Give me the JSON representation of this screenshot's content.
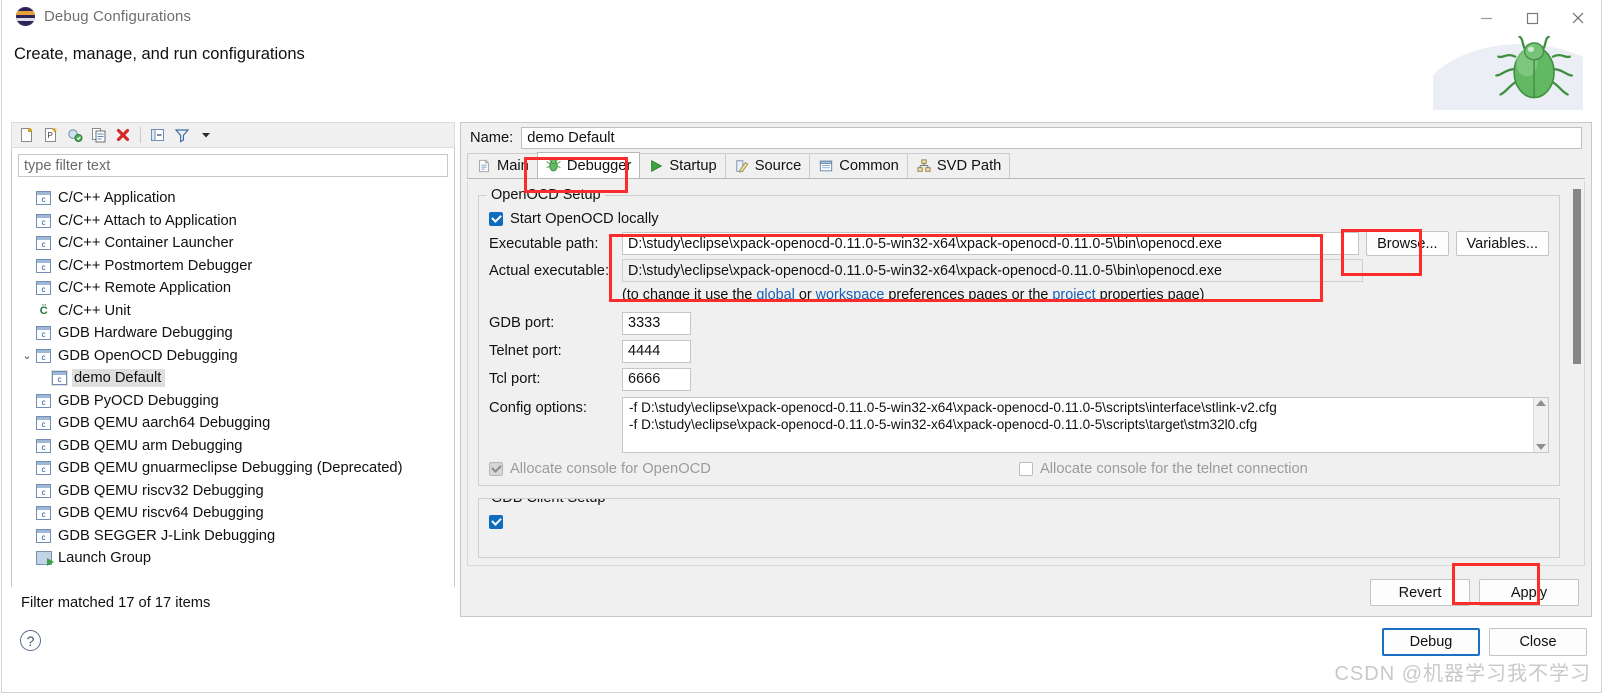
{
  "window": {
    "title": "Debug Configurations",
    "subtitle": "Create, manage, and run configurations",
    "logo_icon": "eclipse-logo",
    "bug_icon": "bug-icon",
    "minimize_label": "—",
    "maximize_label": "□",
    "close_label": "✕"
  },
  "tree_toolbar": {
    "icons": [
      "new-configuration-icon",
      "new-prototype-icon",
      "export-icon",
      "duplicate-icon",
      "delete-icon",
      "collapse-all-icon",
      "filter-icon",
      "view-menu-icon"
    ]
  },
  "filter": {
    "placeholder": "type filter text",
    "value": "type filter text",
    "status": "Filter matched 17 of 17 items"
  },
  "tree": {
    "items": [
      {
        "label": "C/C++ Application",
        "icon": "c-config-icon",
        "depth": 1,
        "twisty": "",
        "selected": false
      },
      {
        "label": "C/C++ Attach to Application",
        "icon": "c-config-icon",
        "depth": 1,
        "twisty": "",
        "selected": false
      },
      {
        "label": "C/C++ Container Launcher",
        "icon": "c-config-icon",
        "depth": 1,
        "twisty": "",
        "selected": false
      },
      {
        "label": "C/C++ Postmortem Debugger",
        "icon": "c-config-icon",
        "depth": 1,
        "twisty": "",
        "selected": false
      },
      {
        "label": "C/C++ Remote Application",
        "icon": "c-config-icon",
        "depth": 1,
        "twisty": "",
        "selected": false
      },
      {
        "label": "C/C++ Unit",
        "icon": "cunit-icon",
        "depth": 1,
        "twisty": "",
        "selected": false
      },
      {
        "label": "GDB Hardware Debugging",
        "icon": "c-config-icon",
        "depth": 1,
        "twisty": "",
        "selected": false
      },
      {
        "label": "GDB OpenOCD Debugging",
        "icon": "c-config-icon",
        "depth": 1,
        "twisty": "expanded",
        "selected": false
      },
      {
        "label": "demo Default",
        "icon": "c-config-icon",
        "depth": 2,
        "twisty": "",
        "selected": true
      },
      {
        "label": "GDB PyOCD Debugging",
        "icon": "c-config-icon",
        "depth": 1,
        "twisty": "",
        "selected": false
      },
      {
        "label": "GDB QEMU aarch64 Debugging",
        "icon": "c-config-icon",
        "depth": 1,
        "twisty": "",
        "selected": false
      },
      {
        "label": "GDB QEMU arm Debugging",
        "icon": "c-config-icon",
        "depth": 1,
        "twisty": "",
        "selected": false
      },
      {
        "label": "GDB QEMU gnuarmeclipse Debugging (Deprecated)",
        "icon": "c-config-icon",
        "depth": 1,
        "twisty": "",
        "selected": false
      },
      {
        "label": "GDB QEMU riscv32 Debugging",
        "icon": "c-config-icon",
        "depth": 1,
        "twisty": "",
        "selected": false
      },
      {
        "label": "GDB QEMU riscv64 Debugging",
        "icon": "c-config-icon",
        "depth": 1,
        "twisty": "",
        "selected": false
      },
      {
        "label": "GDB SEGGER J-Link Debugging",
        "icon": "c-config-icon",
        "depth": 1,
        "twisty": "",
        "selected": false
      },
      {
        "label": "Launch Group",
        "icon": "launch-group-icon",
        "depth": 1,
        "twisty": "",
        "selected": false
      }
    ]
  },
  "config": {
    "name_label": "Name:",
    "name_value": "demo Default",
    "tabs": [
      {
        "label": "Main",
        "icon": "main-document-icon",
        "active": false
      },
      {
        "label": "Debugger",
        "icon": "debugger-bug-icon",
        "active": true
      },
      {
        "label": "Startup",
        "icon": "startup-play-icon",
        "active": false
      },
      {
        "label": "Source",
        "icon": "source-edit-icon",
        "active": false
      },
      {
        "label": "Common",
        "icon": "common-window-icon",
        "active": false
      },
      {
        "label": "SVD Path",
        "icon": "svd-tree-icon",
        "active": false
      }
    ],
    "openocd": {
      "legend": "OpenOCD Setup",
      "start_locally_label": "Start OpenOCD locally",
      "start_locally_checked": true,
      "executable_path_label": "Executable path:",
      "executable_path_value": "D:\\study\\eclipse\\xpack-openocd-0.11.0-5-win32-x64\\xpack-openocd-0.11.0-5\\bin\\openocd.exe",
      "actual_executable_label": "Actual executable:",
      "actual_executable_value": "D:\\study\\eclipse\\xpack-openocd-0.11.0-5-win32-x64\\xpack-openocd-0.11.0-5\\bin\\openocd.exe",
      "browse_label": "Browse...",
      "variables_label": "Variables...",
      "hint_prefix": "(to change it use the ",
      "hint_link1": "global",
      "hint_mid1": " or ",
      "hint_link2": "workspace",
      "hint_mid2": " preferences pages or the ",
      "hint_link3": "project",
      "hint_suffix": " properties page)",
      "gdb_port_label": "GDB port:",
      "gdb_port_value": "3333",
      "telnet_port_label": "Telnet port:",
      "telnet_port_value": "4444",
      "tcl_port_label": "Tcl port:",
      "tcl_port_value": "6666",
      "config_options_label": "Config options:",
      "config_options_lines": [
        "-f D:\\study\\eclipse\\xpack-openocd-0.11.0-5-win32-x64\\xpack-openocd-0.11.0-5\\scripts\\interface\\stlink-v2.cfg",
        "-f D:\\study\\eclipse\\xpack-openocd-0.11.0-5-win32-x64\\xpack-openocd-0.11.0-5\\scripts\\target\\stm32l0.cfg"
      ],
      "allocate_console_openocd_label": "Allocate console for OpenOCD",
      "allocate_console_openocd_checked": true,
      "allocate_console_openocd_disabled": true,
      "allocate_console_telnet_label": "Allocate console for the telnet connection",
      "allocate_console_telnet_checked": false,
      "allocate_console_telnet_disabled": true
    },
    "gdb_client": {
      "legend": "GDB Client Setup"
    },
    "revert_label": "Revert",
    "apply_label": "Apply"
  },
  "footer": {
    "help_label": "?",
    "debug_label": "Debug",
    "close_label": "Close"
  },
  "watermark": "CSDN @机器学习我不学习",
  "colors": {
    "accent": "#0f6cbd",
    "annotation": "#fc2c2c",
    "link": "#1a5fb4",
    "panel": "#f0f0f0"
  }
}
